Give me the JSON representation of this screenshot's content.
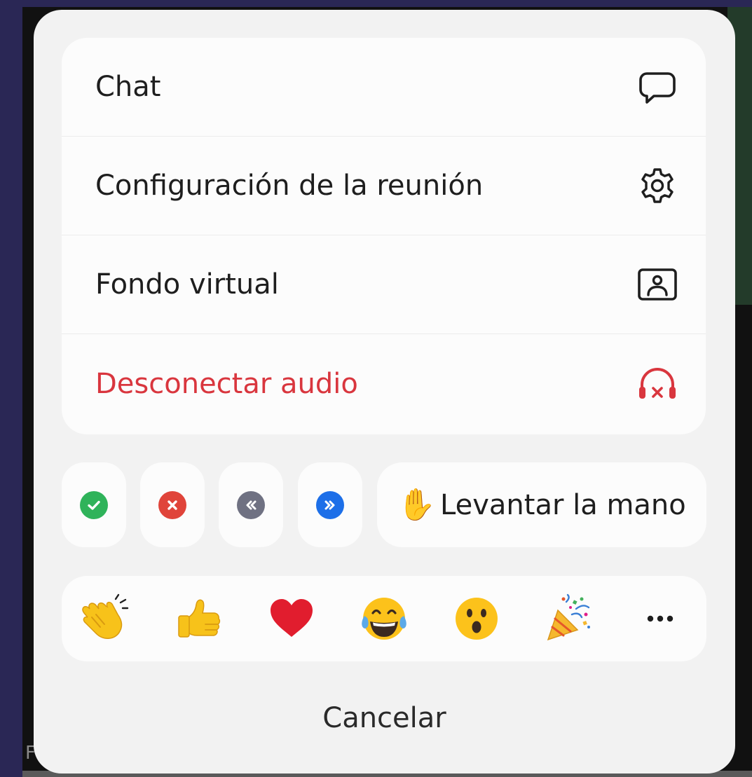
{
  "background": {
    "corner_letter": "F"
  },
  "menu": {
    "items": [
      {
        "label": "Chat",
        "icon": "chat-bubble-icon"
      },
      {
        "label": "Configuración de la reunión",
        "icon": "gear-icon"
      },
      {
        "label": "Fondo virtual",
        "icon": "virtual-background-icon"
      },
      {
        "label": "Desconectar audio",
        "icon": "headphones-disconnect-icon",
        "color": "#d9363e"
      }
    ]
  },
  "quick_actions": {
    "buttons": [
      {
        "icon": "green-check-icon",
        "color": "#2fb35a"
      },
      {
        "icon": "red-x-icon",
        "color": "#e0443a"
      },
      {
        "icon": "slower-icon",
        "color": "#6f7182"
      },
      {
        "icon": "faster-icon",
        "color": "#1d6fe8"
      }
    ],
    "raise_hand": {
      "emoji": "✋",
      "label": "Levantar la mano"
    }
  },
  "reactions": {
    "items": [
      "clapping-hands-icon",
      "thumbs-up-icon",
      "heart-icon",
      "tears-of-joy-icon",
      "surprised-face-icon",
      "party-popper-icon"
    ],
    "more_icon": "more-dots-icon"
  },
  "cancel_label": "Cancelar",
  "colors": {
    "danger": "#d9363e",
    "sheet": "#f2f2f2",
    "card": "#fcfcfc",
    "frame": "#2a2755"
  }
}
